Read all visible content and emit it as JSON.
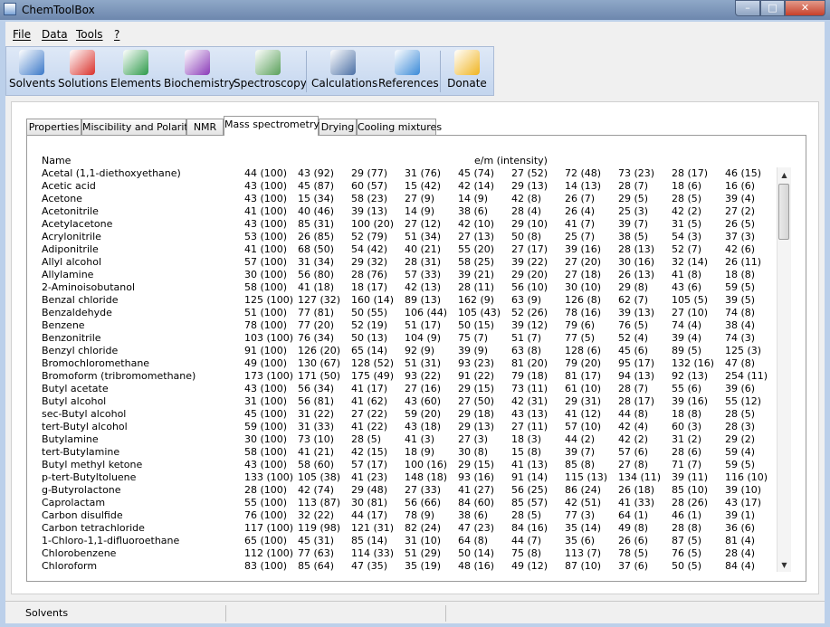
{
  "window": {
    "title": "ChemToolBox"
  },
  "menu": [
    "File",
    "Data",
    "Tools",
    "?"
  ],
  "toolbar": [
    {
      "label": "Solvents",
      "icon": "flask-icon",
      "color": "#3a78c8"
    },
    {
      "label": "Solutions",
      "icon": "molecule-icon",
      "color": "#d9302a"
    },
    {
      "label": "Elements",
      "icon": "cubes-icon",
      "color": "#2e9a4a"
    },
    {
      "label": "Biochemistry",
      "icon": "dna-icon",
      "color": "#8a3ab8"
    },
    {
      "label": "Spectroscopy",
      "icon": "spectrum-icon",
      "color": "#5aa05a"
    },
    {
      "label": "Calculations",
      "icon": "calculator-icon",
      "color": "#4a6fa5"
    },
    {
      "label": "References",
      "icon": "book-icon",
      "color": "#3a8ad8"
    },
    {
      "label": "Donate",
      "icon": "paypal-icon",
      "color": "#f0b420"
    }
  ],
  "tabs": [
    "Properties",
    "Miscibility and Polarity",
    "NMR",
    "Mass spectrometry",
    "Drying",
    "Cooling mixtures"
  ],
  "active_tab": "Mass spectrometry",
  "table": {
    "header_name": "Name",
    "header_values": "e/m (intensity)",
    "rows": [
      {
        "name": "Acetal (1,1-diethoxyethane)",
        "v": [
          "44 (100)",
          "43 (92)",
          "29 (77)",
          "31 (76)",
          "45 (74)",
          "27 (52)",
          "72 (48)",
          "73 (23)",
          "28 (17)",
          "46 (15)"
        ]
      },
      {
        "name": "Acetic acid",
        "v": [
          "43 (100)",
          "45 (87)",
          "60 (57)",
          "15 (42)",
          "42 (14)",
          "29 (13)",
          "14 (13)",
          "28 (7)",
          "18 (6)",
          "16 (6)"
        ]
      },
      {
        "name": "Acetone",
        "v": [
          "43 (100)",
          "15 (34)",
          "58 (23)",
          "27 (9)",
          "14 (9)",
          "42 (8)",
          "26 (7)",
          "29 (5)",
          "28 (5)",
          "39 (4)"
        ]
      },
      {
        "name": "Acetonitrile",
        "v": [
          "41 (100)",
          "40 (46)",
          "39 (13)",
          "14 (9)",
          "38 (6)",
          "28 (4)",
          "26 (4)",
          "25 (3)",
          "42 (2)",
          "27 (2)"
        ]
      },
      {
        "name": "Acetylacetone",
        "v": [
          "43 (100)",
          "85 (31)",
          "100 (20)",
          "27 (12)",
          "42 (10)",
          "29 (10)",
          "41 (7)",
          "39 (7)",
          "31 (5)",
          "26 (5)"
        ]
      },
      {
        "name": "Acrylonitrile",
        "v": [
          "53 (100)",
          "26 (85)",
          "52 (79)",
          "51 (34)",
          "27 (13)",
          "50 (8)",
          "25 (7)",
          "38 (5)",
          "54 (3)",
          "37 (3)"
        ]
      },
      {
        "name": "Adiponitrile",
        "v": [
          "41 (100)",
          "68 (50)",
          "54 (42)",
          "40 (21)",
          "55 (20)",
          "27 (17)",
          "39 (16)",
          "28 (13)",
          "52 (7)",
          "42 (6)"
        ]
      },
      {
        "name": "Allyl alcohol",
        "v": [
          "57 (100)",
          "31 (34)",
          "29 (32)",
          "28 (31)",
          "58 (25)",
          "39 (22)",
          "27 (20)",
          "30 (16)",
          "32 (14)",
          "26 (11)"
        ]
      },
      {
        "name": "Allylamine",
        "v": [
          "30 (100)",
          "56 (80)",
          "28 (76)",
          "57 (33)",
          "39 (21)",
          "29 (20)",
          "27 (18)",
          "26 (13)",
          "41 (8)",
          "18 (8)"
        ]
      },
      {
        "name": "2-Aminoisobutanol",
        "v": [
          "58 (100)",
          "41 (18)",
          "18 (17)",
          "42 (13)",
          "28 (11)",
          "56 (10)",
          "30 (10)",
          "29 (8)",
          "43 (6)",
          "59 (5)"
        ]
      },
      {
        "name": "Benzal chloride",
        "v": [
          "125 (100)",
          "127 (32)",
          "160 (14)",
          "89 (13)",
          "162 (9)",
          "63 (9)",
          "126 (8)",
          "62 (7)",
          "105 (5)",
          "39 (5)"
        ]
      },
      {
        "name": "Benzaldehyde",
        "v": [
          "51 (100)",
          "77 (81)",
          "50 (55)",
          "106 (44)",
          "105 (43)",
          "52 (26)",
          "78 (16)",
          "39 (13)",
          "27 (10)",
          "74 (8)"
        ]
      },
      {
        "name": "Benzene",
        "v": [
          "78 (100)",
          "77 (20)",
          "52 (19)",
          "51 (17)",
          "50 (15)",
          "39 (12)",
          "79 (6)",
          "76 (5)",
          "74 (4)",
          "38 (4)"
        ]
      },
      {
        "name": "Benzonitrile",
        "v": [
          "103 (100)",
          "76 (34)",
          "50 (13)",
          "104 (9)",
          "75 (7)",
          "51 (7)",
          "77 (5)",
          "52 (4)",
          "39 (4)",
          "74 (3)"
        ]
      },
      {
        "name": "Benzyl chloride",
        "v": [
          "91 (100)",
          "126 (20)",
          "65 (14)",
          "92 (9)",
          "39 (9)",
          "63 (8)",
          "128 (6)",
          "45 (6)",
          "89 (5)",
          "125 (3)"
        ]
      },
      {
        "name": "Bromochloromethane",
        "v": [
          "49 (100)",
          "130 (67)",
          "128 (52)",
          "51 (31)",
          "93 (23)",
          "81 (20)",
          "79 (20)",
          "95 (17)",
          "132 (16)",
          "47 (8)"
        ]
      },
      {
        "name": "Bromoform (tribromomethane)",
        "v": [
          "173 (100)",
          "171 (50)",
          "175 (49)",
          "93 (22)",
          "91 (22)",
          "79 (18)",
          "81 (17)",
          "94 (13)",
          "92 (13)",
          "254 (11)"
        ]
      },
      {
        "name": "Butyl acetate",
        "v": [
          "43 (100)",
          "56 (34)",
          "41 (17)",
          "27 (16)",
          "29 (15)",
          "73 (11)",
          "61 (10)",
          "28 (7)",
          "55 (6)",
          "39 (6)"
        ]
      },
      {
        "name": "Butyl alcohol",
        "v": [
          "31 (100)",
          "56 (81)",
          "41 (62)",
          "43 (60)",
          "27 (50)",
          "42 (31)",
          "29 (31)",
          "28 (17)",
          "39 (16)",
          "55 (12)"
        ]
      },
      {
        "name": "sec-Butyl alcohol",
        "v": [
          "45 (100)",
          "31 (22)",
          "27 (22)",
          "59 (20)",
          "29 (18)",
          "43 (13)",
          "41 (12)",
          "44 (8)",
          "18 (8)",
          "28 (5)"
        ]
      },
      {
        "name": "tert-Butyl alcohol",
        "v": [
          "59 (100)",
          "31 (33)",
          "41 (22)",
          "43 (18)",
          "29 (13)",
          "27 (11)",
          "57 (10)",
          "42 (4)",
          "60 (3)",
          "28 (3)"
        ]
      },
      {
        "name": "Butylamine",
        "v": [
          "30 (100)",
          "73 (10)",
          "28 (5)",
          "41 (3)",
          "27 (3)",
          "18 (3)",
          "44 (2)",
          "42 (2)",
          "31 (2)",
          "29 (2)"
        ]
      },
      {
        "name": "tert-Butylamine",
        "v": [
          "58 (100)",
          "41 (21)",
          "42 (15)",
          "18 (9)",
          "30 (8)",
          "15 (8)",
          "39 (7)",
          "57 (6)",
          "28 (6)",
          "59 (4)"
        ]
      },
      {
        "name": "Butyl methyl ketone",
        "v": [
          "43 (100)",
          "58 (60)",
          "57 (17)",
          "100 (16)",
          "29 (15)",
          "41 (13)",
          "85 (8)",
          "27 (8)",
          "71 (7)",
          "59 (5)"
        ]
      },
      {
        "name": "p-tert-Butyltoluene",
        "v": [
          "133 (100)",
          "105 (38)",
          "41 (23)",
          "148 (18)",
          "93 (16)",
          "91 (14)",
          "115 (13)",
          "134 (11)",
          "39 (11)",
          "116 (10)"
        ]
      },
      {
        "name": "g-Butyrolactone",
        "v": [
          "28 (100)",
          "42 (74)",
          "29 (48)",
          "27 (33)",
          "41 (27)",
          "56 (25)",
          "86 (24)",
          "26 (18)",
          "85 (10)",
          "39 (10)"
        ]
      },
      {
        "name": "Caprolactam",
        "v": [
          "55 (100)",
          "113 (87)",
          "30 (81)",
          "56 (66)",
          "84 (60)",
          "85 (57)",
          "42 (51)",
          "41 (33)",
          "28 (26)",
          "43 (17)"
        ]
      },
      {
        "name": "Carbon disulfide",
        "v": [
          "76 (100)",
          "32 (22)",
          "44 (17)",
          "78 (9)",
          "38 (6)",
          "28 (5)",
          "77 (3)",
          "64 (1)",
          "46 (1)",
          "39 (1)"
        ]
      },
      {
        "name": "Carbon tetrachloride",
        "v": [
          "117 (100)",
          "119 (98)",
          "121 (31)",
          "82 (24)",
          "47 (23)",
          "84 (16)",
          "35 (14)",
          "49 (8)",
          "28 (8)",
          "36 (6)"
        ]
      },
      {
        "name": "1-Chloro-1,1-difluoroethane",
        "v": [
          "65 (100)",
          "45 (31)",
          "85 (14)",
          "31 (10)",
          "64 (8)",
          "44 (7)",
          "35 (6)",
          "26 (6)",
          "87 (5)",
          "81 (4)"
        ]
      },
      {
        "name": "Chlorobenzene",
        "v": [
          "112 (100)",
          "77 (63)",
          "114 (33)",
          "51 (29)",
          "50 (14)",
          "75 (8)",
          "113 (7)",
          "78 (5)",
          "76 (5)",
          "28 (4)"
        ]
      },
      {
        "name": "Chloroform",
        "v": [
          "83 (100)",
          "85 (64)",
          "47 (35)",
          "35 (19)",
          "48 (16)",
          "49 (12)",
          "87 (10)",
          "37 (6)",
          "50 (5)",
          "84 (4)"
        ]
      }
    ]
  },
  "status": {
    "text": "Solvents"
  }
}
